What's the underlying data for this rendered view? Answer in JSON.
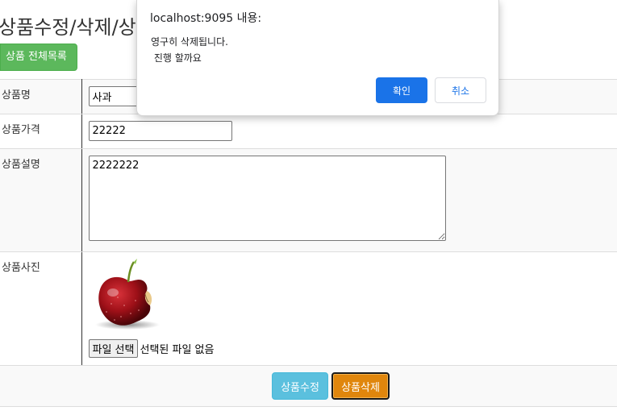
{
  "page": {
    "title": "상품수정/삭제/상",
    "list_button": "상품 전체목록"
  },
  "form": {
    "name_label": "상품명",
    "name_value": "사과",
    "price_label": "상품가격",
    "price_value": "22222",
    "desc_label": "상품설명",
    "desc_value": "2222222",
    "photo_label": "상품사진",
    "photo_icon": "apple-image",
    "file_button": "파일 선택",
    "file_status": "선택된 파일 없음",
    "update_button": "상품수정",
    "delete_button": "상품삭제"
  },
  "dialog": {
    "title": "localhost:9095 내용:",
    "message": "영구히 삭제됩니다.\n 진행 할까요",
    "ok_label": "확인",
    "cancel_label": "취소"
  },
  "colors": {
    "list_button": "#5cb85c",
    "update_button": "#5bc0de",
    "delete_button": "#e0860c",
    "dialog_ok": "#1a73e8"
  }
}
